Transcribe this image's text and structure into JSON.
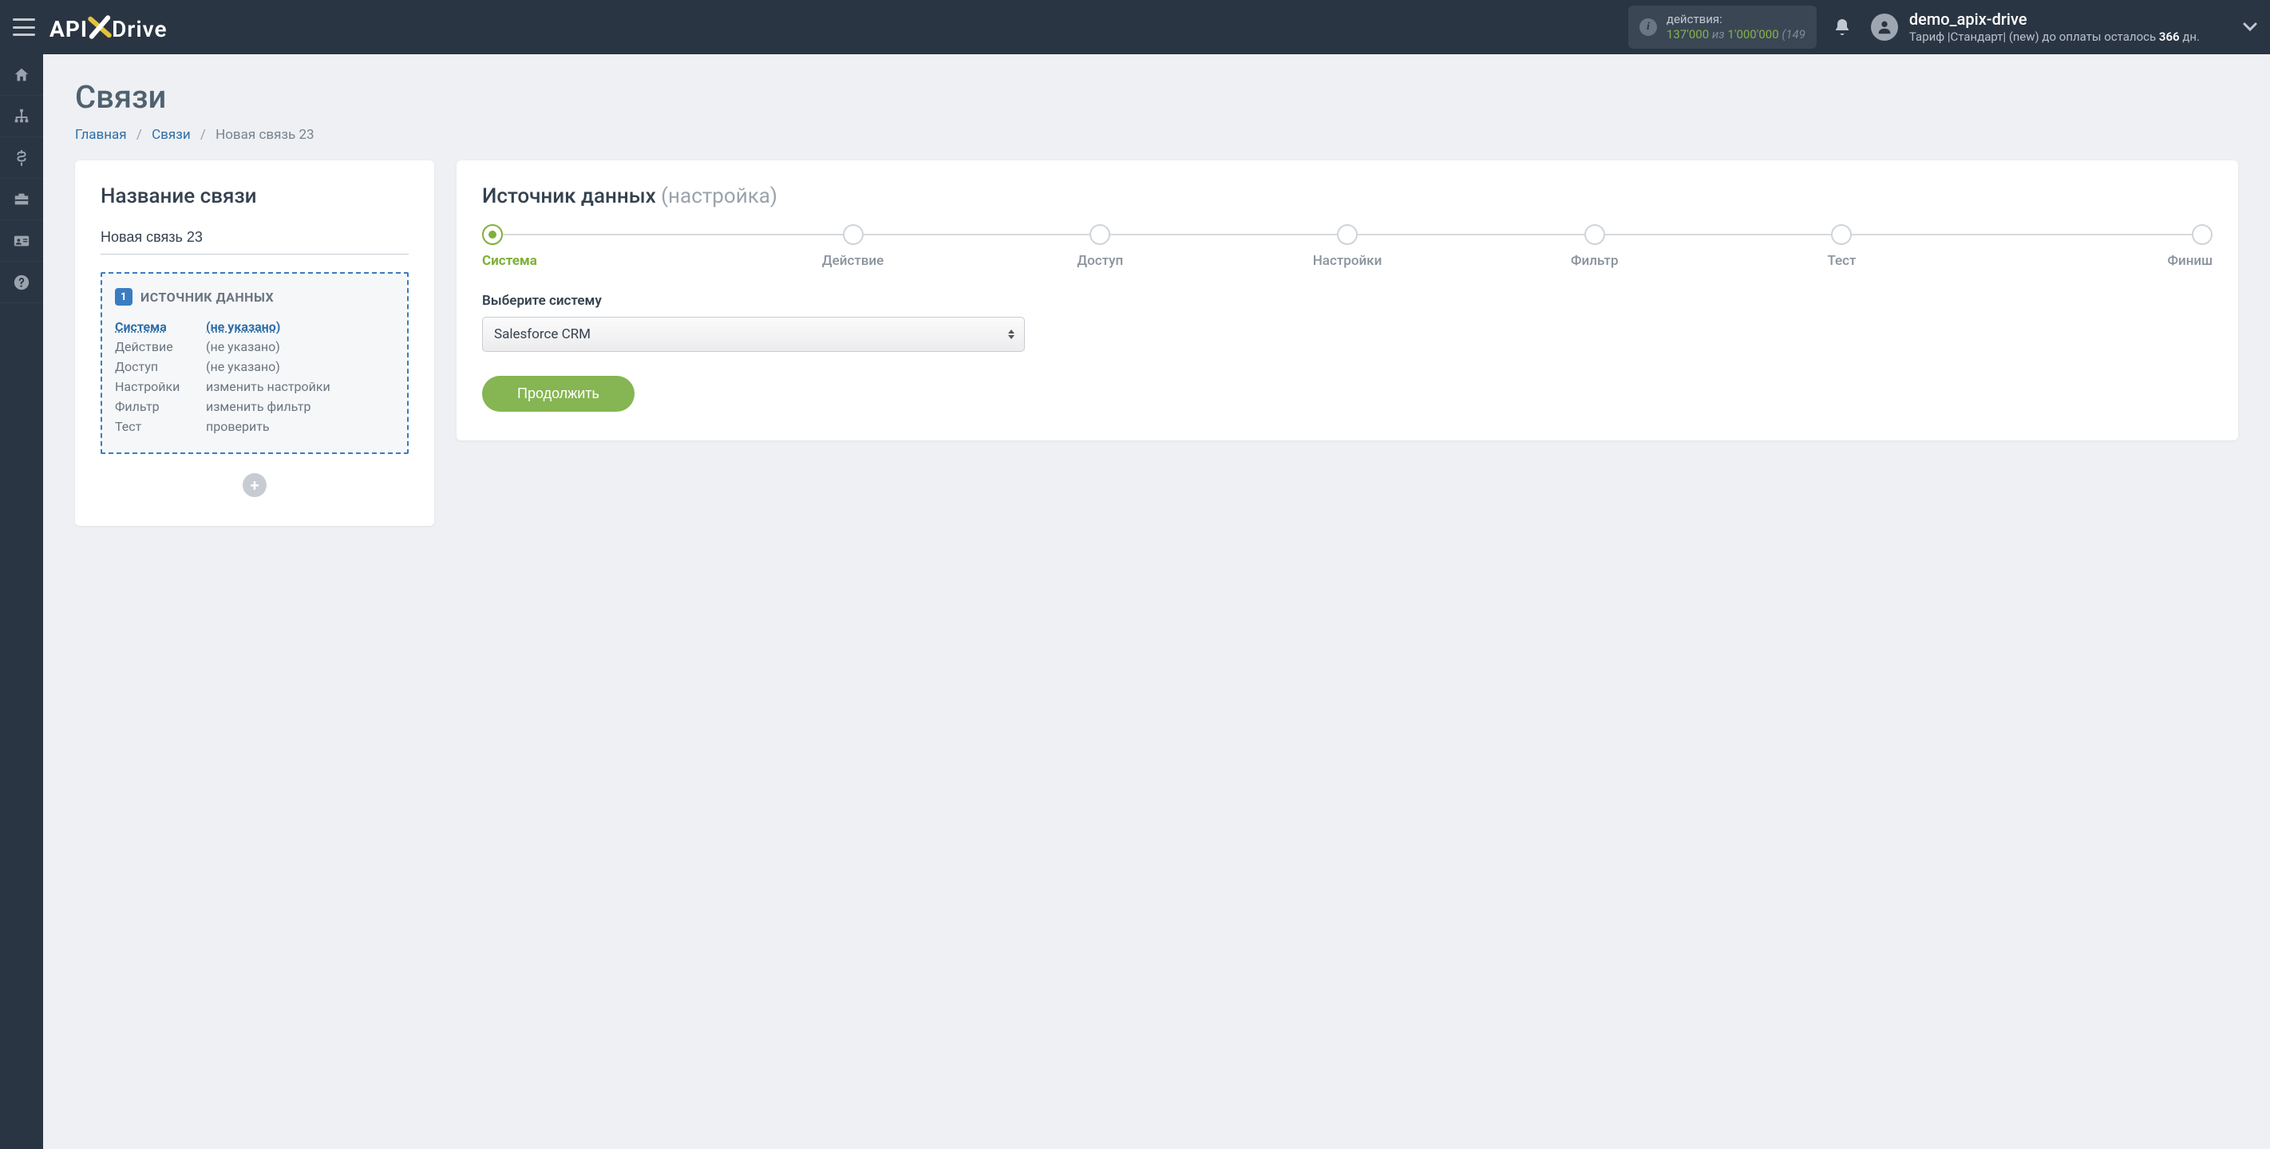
{
  "header": {
    "logo": {
      "api": "API",
      "drive": "Drive"
    },
    "actions_label": "действия:",
    "actions_used": "137'000",
    "actions_of_word": "из",
    "actions_total": "1'000'000",
    "actions_tail": "(149",
    "username": "demo_apix-drive",
    "plan_prefix": "Тариф |Стандарт| (new) до оплаты осталось ",
    "plan_days": "366",
    "plan_suffix": " дн."
  },
  "sidebar": {
    "items": [
      {
        "name": "home"
      },
      {
        "name": "connections"
      },
      {
        "name": "billing"
      },
      {
        "name": "briefcase"
      },
      {
        "name": "id-card"
      },
      {
        "name": "help"
      }
    ]
  },
  "page": {
    "title": "Связи",
    "breadcrumb": {
      "home": "Главная",
      "links": "Связи",
      "current": "Новая связь 23"
    }
  },
  "left": {
    "heading": "Название связи",
    "name_value": "Новая связь 23",
    "src_heading": "ИСТОЧНИК ДАННЫХ",
    "badge": "1",
    "rows": [
      {
        "k": "Система",
        "v": "(не указано)",
        "active": true
      },
      {
        "k": "Действие",
        "v": "(не указано)",
        "active": false
      },
      {
        "k": "Доступ",
        "v": "(не указано)",
        "active": false
      },
      {
        "k": "Настройки",
        "v": "изменить настройки",
        "active": false
      },
      {
        "k": "Фильтр",
        "v": "изменить фильтр",
        "active": false
      },
      {
        "k": "Тест",
        "v": "проверить",
        "active": false
      }
    ]
  },
  "right": {
    "heading_main": "Источник данных ",
    "heading_sub": "(настройка)",
    "steps": [
      {
        "label": "Система",
        "active": true
      },
      {
        "label": "Действие",
        "active": false
      },
      {
        "label": "Доступ",
        "active": false
      },
      {
        "label": "Настройки",
        "active": false
      },
      {
        "label": "Фильтр",
        "active": false
      },
      {
        "label": "Тест",
        "active": false
      },
      {
        "label": "Финиш",
        "active": false
      }
    ],
    "field_label": "Выберите систему",
    "select_value": "Salesforce CRM",
    "continue": "Продолжить"
  }
}
